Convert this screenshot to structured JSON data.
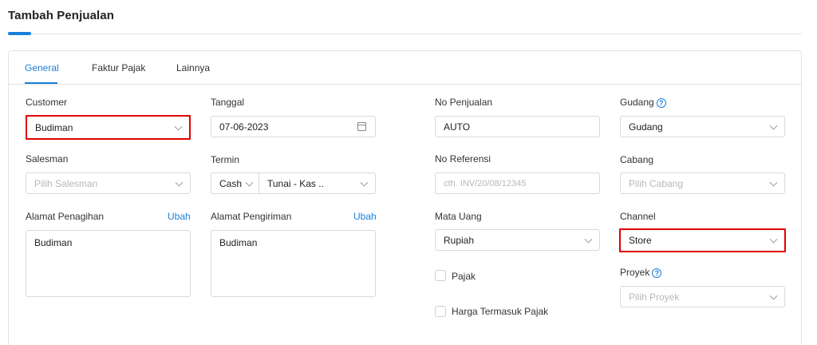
{
  "page": {
    "title": "Tambah Penjualan"
  },
  "tabs": [
    "General",
    "Faktur Pajak",
    "Lainnya"
  ],
  "form": {
    "customer": {
      "label": "Customer",
      "value": "Budiman"
    },
    "tanggal": {
      "label": "Tanggal",
      "value": "07-06-2023"
    },
    "no_penjualan": {
      "label": "No Penjualan",
      "value": "AUTO"
    },
    "gudang": {
      "label": "Gudang",
      "value": "Gudang"
    },
    "salesman": {
      "label": "Salesman",
      "placeholder": "Pilih Salesman"
    },
    "termin": {
      "label": "Termin",
      "type": "Cash",
      "account": "Tunai - Kas .."
    },
    "no_referensi": {
      "label": "No Referensi",
      "placeholder": "cth. INV/20/08/12345"
    },
    "cabang": {
      "label": "Cabang",
      "placeholder": "Pilih Cabang"
    },
    "alamat_penagihan": {
      "label": "Alamat Penagihan",
      "link": "Ubah",
      "value": "Budiman"
    },
    "alamat_pengiriman": {
      "label": "Alamat Pengiriman",
      "link": "Ubah",
      "value": "Budiman"
    },
    "mata_uang": {
      "label": "Mata Uang",
      "value": "Rupiah"
    },
    "channel": {
      "label": "Channel",
      "value": "Store"
    },
    "pajak": {
      "label": "Pajak"
    },
    "harga_termasuk_pajak": {
      "label": "Harga Termasuk Pajak"
    },
    "proyek": {
      "label": "Proyek",
      "placeholder": "Pilih Proyek"
    }
  },
  "icons": {
    "help": "?"
  },
  "colors": {
    "accent": "#1a7fd9",
    "highlight": "#e10000"
  }
}
